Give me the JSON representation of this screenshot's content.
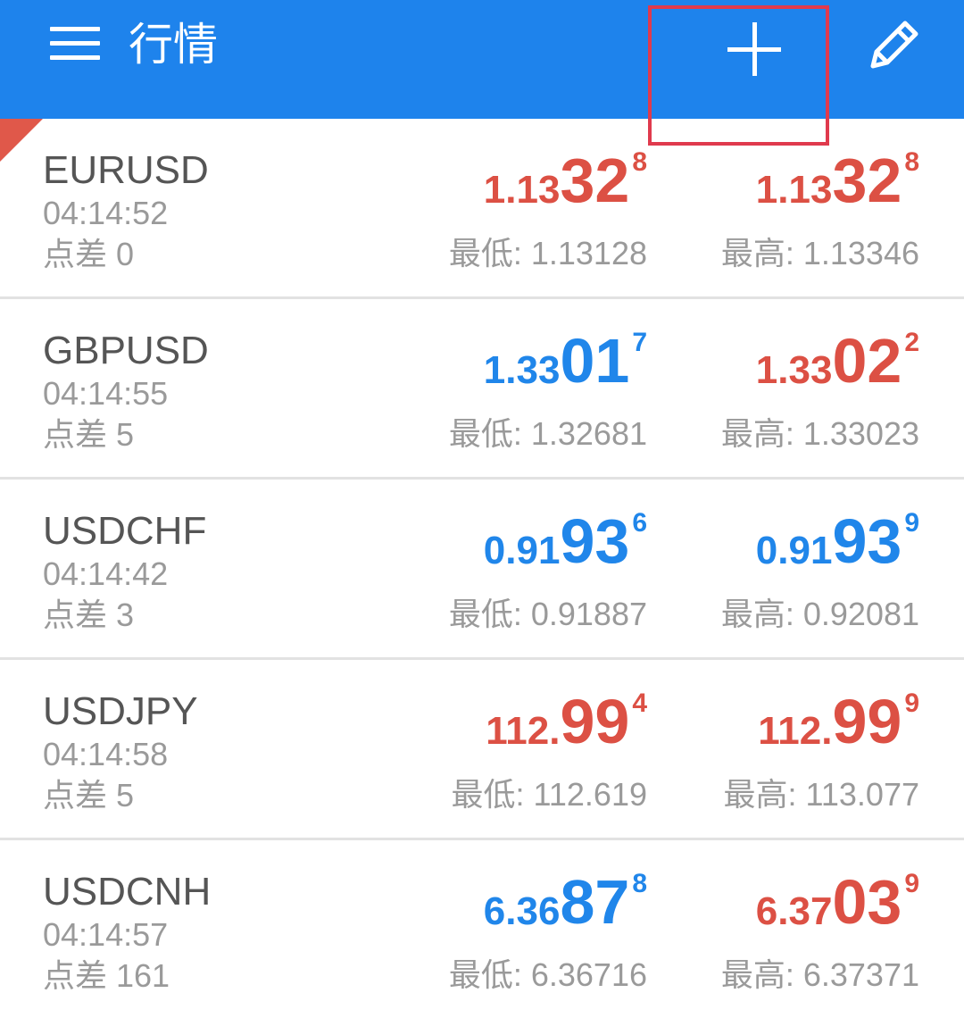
{
  "header": {
    "title": "行情",
    "menu_icon": "menu-icon",
    "add_icon": "plus-icon",
    "edit_icon": "pencil-icon"
  },
  "colors": {
    "appbar": "#1e83ec",
    "price_up": "#dc5044",
    "price_down": "#2086ea",
    "highlight": "#e03a4d"
  },
  "quotes": [
    {
      "symbol": "EURUSD",
      "time": "04:14:52",
      "spread_label": "点差 0",
      "bid": {
        "pre": "1.13",
        "big": "32",
        "sup": "8",
        "color": "red"
      },
      "ask": {
        "pre": "1.13",
        "big": "32",
        "sup": "8",
        "color": "red"
      },
      "low": "最低: 1.13128",
      "high": "最高: 1.13346"
    },
    {
      "symbol": "GBPUSD",
      "time": "04:14:55",
      "spread_label": "点差 5",
      "bid": {
        "pre": "1.33",
        "big": "01",
        "sup": "7",
        "color": "blue"
      },
      "ask": {
        "pre": "1.33",
        "big": "02",
        "sup": "2",
        "color": "red"
      },
      "low": "最低: 1.32681",
      "high": "最高: 1.33023"
    },
    {
      "symbol": "USDCHF",
      "time": "04:14:42",
      "spread_label": "点差 3",
      "bid": {
        "pre": "0.91",
        "big": "93",
        "sup": "6",
        "color": "blue"
      },
      "ask": {
        "pre": "0.91",
        "big": "93",
        "sup": "9",
        "color": "blue"
      },
      "low": "最低: 0.91887",
      "high": "最高: 0.92081"
    },
    {
      "symbol": "USDJPY",
      "time": "04:14:58",
      "spread_label": "点差 5",
      "bid": {
        "pre": "112.",
        "big": "99",
        "sup": "4",
        "color": "red"
      },
      "ask": {
        "pre": "112.",
        "big": "99",
        "sup": "9",
        "color": "red"
      },
      "low": "最低: 112.619",
      "high": "最高: 113.077"
    },
    {
      "symbol": "USDCNH",
      "time": "04:14:57",
      "spread_label": "点差 161",
      "bid": {
        "pre": "6.36",
        "big": "87",
        "sup": "8",
        "color": "blue"
      },
      "ask": {
        "pre": "6.37",
        "big": "03",
        "sup": "9",
        "color": "red"
      },
      "low": "最低: 6.36716",
      "high": "最高: 6.37371"
    }
  ]
}
